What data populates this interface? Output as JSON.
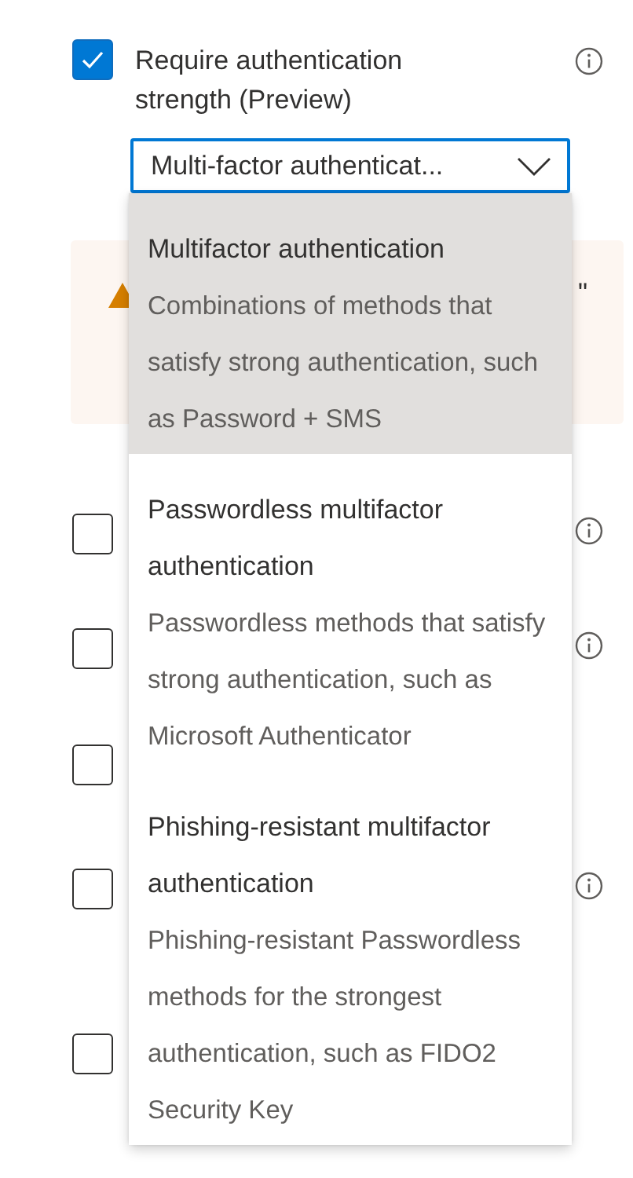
{
  "require_strength": {
    "label": "Require authentication strength (Preview)",
    "checked": true,
    "info": true
  },
  "strength_dropdown": {
    "value": "Multi-factor authenticat...",
    "expanded": true,
    "options": [
      {
        "title": "Multifactor authentication",
        "description": "Combinations of methods that satisfy strong authentication, such as Password + SMS",
        "selected": true
      },
      {
        "title": "Passwordless multifactor authentication",
        "description": "Passwordless methods that satisfy strong authentication, such as Microsoft Authenticator",
        "selected": false
      },
      {
        "title": "Phishing-resistant multifactor authentication",
        "description": "Phishing-resistant Passwordless methods for the strongest authentication, such as FIDO2 Security Key",
        "selected": false
      }
    ]
  },
  "warning": {
    "visible_text": "\""
  },
  "other_checkboxes": [
    {
      "checked": false,
      "info": true
    },
    {
      "checked": false,
      "info": true
    },
    {
      "checked": false,
      "info": false
    },
    {
      "checked": false,
      "info": true
    },
    {
      "checked": false,
      "info": false
    }
  ]
}
